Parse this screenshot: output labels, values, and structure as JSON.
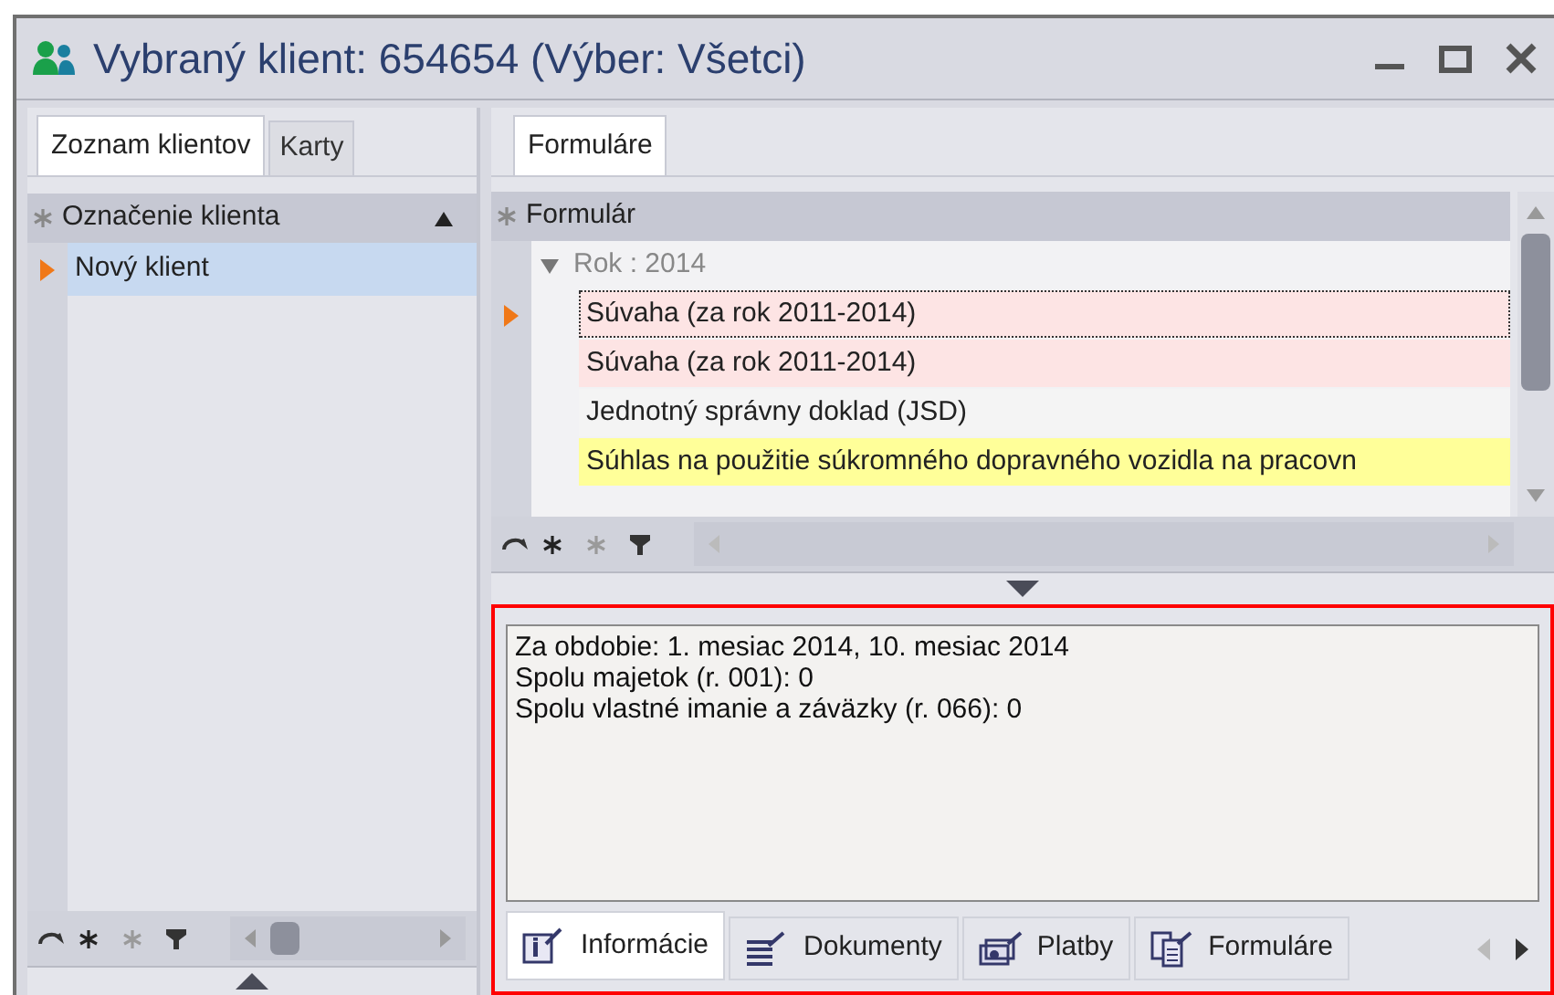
{
  "window": {
    "title": "Vybraný klient: 654654 (Výber: Všetci)"
  },
  "left_panel": {
    "tabs": [
      {
        "label": "Zoznam klientov",
        "selected": true
      },
      {
        "label": "Karty",
        "selected": false
      }
    ],
    "grid": {
      "column": "Označenie klienta",
      "rows": [
        {
          "label": "Nový klient",
          "selected": true
        }
      ]
    }
  },
  "right_panel": {
    "tabs": [
      {
        "label": "Formuláre",
        "selected": true
      }
    ],
    "grid": {
      "column": "Formulár",
      "group": "Rok : 2014",
      "rows": [
        {
          "label": "Súvaha (za rok 2011-2014)",
          "selected": true,
          "color": "#fde4e4"
        },
        {
          "label": "Súvaha (za rok 2011-2014)",
          "selected": false,
          "color": "#fde4e4"
        },
        {
          "label": "Jednotný správny doklad (JSD)",
          "selected": false,
          "color": "#f4f4f4"
        },
        {
          "label": "Súhlas na použitie súkromného dopravného vozidla na pracovn",
          "selected": false,
          "color": "#ffff99"
        }
      ]
    }
  },
  "details": {
    "lines": [
      "Za obdobie: 1. mesiac 2014, 10. mesiac 2014",
      "Spolu majetok (r. 001): 0",
      "Spolu vlastné imanie a záväzky (r. 066): 0"
    ],
    "tabs": [
      {
        "label": "Informácie",
        "selected": true,
        "kind": "info"
      },
      {
        "label": "Dokumenty",
        "selected": false,
        "kind": "documents"
      },
      {
        "label": "Platby",
        "selected": false,
        "kind": "payments"
      },
      {
        "label": "Formuláre",
        "selected": false,
        "kind": "forms"
      }
    ]
  }
}
